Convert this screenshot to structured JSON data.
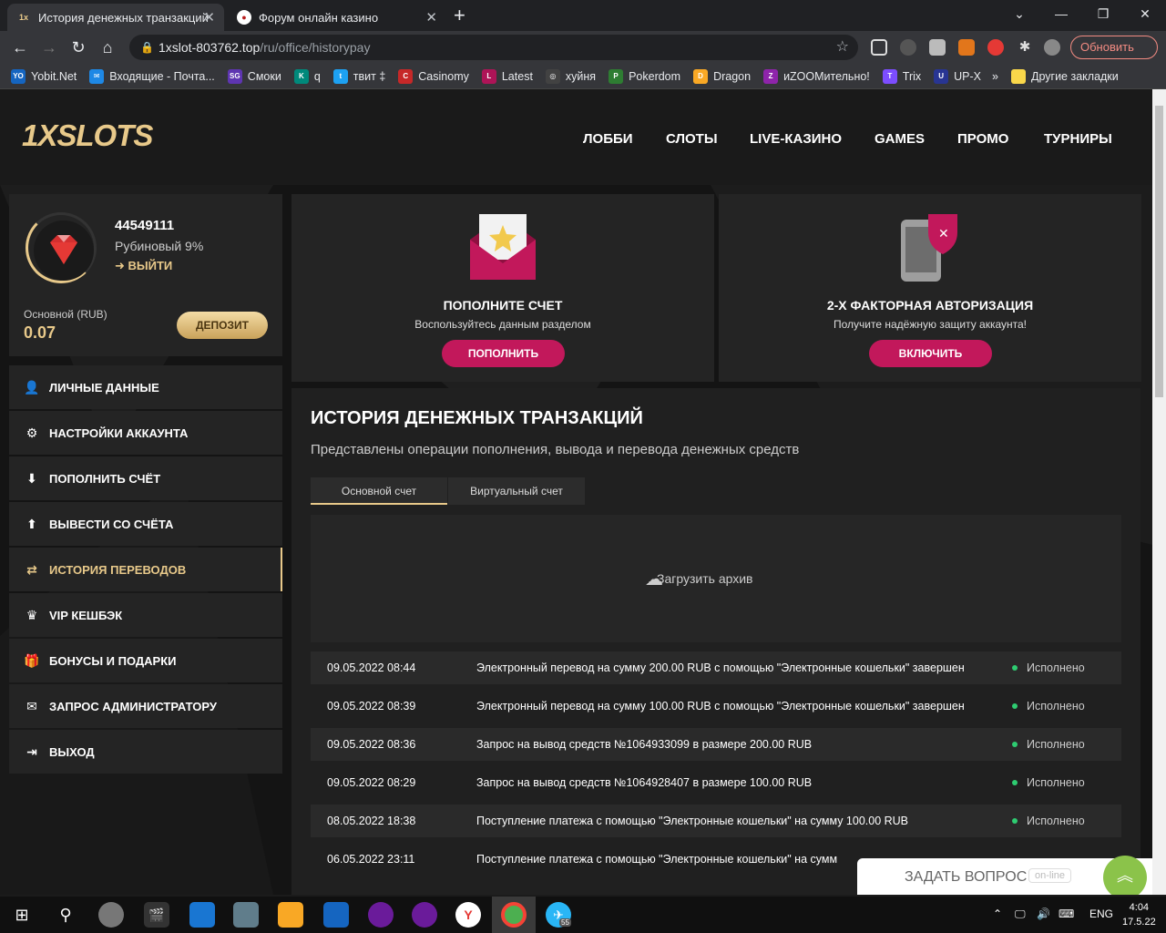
{
  "browser": {
    "tabs": [
      {
        "title": "История денежных транзакций",
        "favicon": "1x",
        "active": true
      },
      {
        "title": "Форум онлайн казино",
        "favicon": "forum",
        "active": false
      }
    ],
    "new_tab": "+",
    "url_host": "1xslot-803762.top",
    "url_path": "/ru/office/historypay",
    "update_button": "Обновить",
    "window_controls": {
      "minimize": "—",
      "maximize": "❐",
      "close": "✕"
    }
  },
  "bookmarks": [
    {
      "label": "Yobit.Net",
      "icon": "yobit-icon",
      "color": "#1565c0",
      "glyph": "YO"
    },
    {
      "label": "Входящие - Почта...",
      "icon": "mail-icon",
      "color": "#1e88e5",
      "glyph": "✉"
    },
    {
      "label": "Смоки",
      "icon": "smoke-icon",
      "color": "#5e35b1",
      "glyph": "SG"
    },
    {
      "label": "q",
      "icon": "k-icon",
      "color": "#00897b",
      "glyph": "K"
    },
    {
      "label": "твит ‡",
      "icon": "twitter-icon",
      "color": "#1da1f2",
      "glyph": "t"
    },
    {
      "label": "Casinomy",
      "icon": "casinomy-icon",
      "color": "#c62828",
      "glyph": "C"
    },
    {
      "label": "Latest",
      "icon": "latest-icon",
      "color": "#ad1457",
      "glyph": "L"
    },
    {
      "label": "хуйня",
      "icon": "circle-icon",
      "color": "#424242",
      "glyph": "◎"
    },
    {
      "label": "Pokerdom",
      "icon": "pokerdom-icon",
      "color": "#2e7d32",
      "glyph": "P"
    },
    {
      "label": "Dragon",
      "icon": "dragon-icon",
      "color": "#f9a825",
      "glyph": "D"
    },
    {
      "label": "иZOOМительно!",
      "icon": "zoom-icon",
      "color": "#8e24aa",
      "glyph": "Z"
    },
    {
      "label": "Trix",
      "icon": "trix-icon",
      "color": "#7c4dff",
      "glyph": "T"
    },
    {
      "label": "UP-X",
      "icon": "upx-icon",
      "color": "#283593",
      "glyph": "U"
    }
  ],
  "bookmarks_more": "»",
  "bookmarks_other": "Другие закладки",
  "site": {
    "logo": "1XSLOTS",
    "nav": [
      "ЛОББИ",
      "СЛОТЫ",
      "LIVE-КАЗИНО",
      "GAMES",
      "ПРОМО",
      "ТУРНИРЫ"
    ]
  },
  "profile": {
    "user_id": "44549111",
    "status": "Рубиновый 9%",
    "logout": "ВЫЙТИ",
    "balance_label": "Основной (RUB)",
    "balance": "0.07",
    "deposit_button": "ДЕПОЗИТ"
  },
  "menu": [
    {
      "label": "ЛИЧНЫЕ ДАННЫЕ",
      "icon": "user-edit-icon",
      "glyph": "👤"
    },
    {
      "label": "НАСТРОЙКИ АККАУНТА",
      "icon": "gears-icon",
      "glyph": "⚙"
    },
    {
      "label": "ПОПОЛНИТЬ СЧЁТ",
      "icon": "download-icon",
      "glyph": "⬇"
    },
    {
      "label": "ВЫВЕСТИ СО СЧЁТА",
      "icon": "upload-icon",
      "glyph": "⬆"
    },
    {
      "label": "ИСТОРИЯ ПЕРЕВОДОВ",
      "icon": "transfer-icon",
      "glyph": "⇄",
      "active": true
    },
    {
      "label": "VIP КЕШБЭК",
      "icon": "crown-icon",
      "glyph": "♛"
    },
    {
      "label": "БОНУСЫ И ПОДАРКИ",
      "icon": "gift-icon",
      "glyph": "🎁"
    },
    {
      "label": "ЗАПРОС АДМИНИСТРАТОРУ",
      "icon": "envelope-icon",
      "glyph": "✉"
    },
    {
      "label": "ВЫХОД",
      "icon": "exit-icon",
      "glyph": "⇥"
    }
  ],
  "cards": [
    {
      "title": "ПОПОЛНИТЕ СЧЕТ",
      "subtitle": "Воспользуйтесь данным разделом",
      "button": "ПОПОЛНИТЬ",
      "icon": "envelope-star-icon"
    },
    {
      "title": "2-Х ФАКТОРНАЯ АВТОРИЗАЦИЯ",
      "subtitle": "Получите надёжную защиту аккаунта!",
      "button": "ВКЛЮЧИТЬ",
      "icon": "phone-shield-icon"
    }
  ],
  "history": {
    "title": "ИСТОРИЯ ДЕНЕЖНЫХ ТРАНЗАКЦИЙ",
    "subtitle": "Представлены операции пополнения, вывода и перевода денежных средств",
    "tabs": [
      "Основной счет",
      "Виртуальный счет"
    ],
    "archive": "Загрузить архив",
    "rows": [
      {
        "date": "09.05.2022 08:44",
        "text": "Электронный перевод на сумму 200.00 RUB с помощью \"Электронные кошельки\" завершен",
        "status": "Исполнено"
      },
      {
        "date": "09.05.2022 08:39",
        "text": "Электронный перевод на сумму 100.00 RUB с помощью \"Электронные кошельки\" завершен",
        "status": "Исполнено"
      },
      {
        "date": "09.05.2022 08:36",
        "text": "Запрос на вывод средств №1064933099 в размере 200.00 RUB",
        "status": "Исполнено"
      },
      {
        "date": "09.05.2022 08:29",
        "text": "Запрос на вывод средств №1064928407 в размере 100.00 RUB",
        "status": "Исполнено"
      },
      {
        "date": "08.05.2022 18:38",
        "text": "Поступление платежа с помощью \"Электронные кошельки\" на сумму 100.00 RUB",
        "status": "Исполнено"
      },
      {
        "date": "06.05.2022 23:11",
        "text": "Поступление платежа с помощью \"Электронные кошельки\" на сумм",
        "status": ""
      }
    ]
  },
  "chat": {
    "label": "ЗАДАТЬ ВОПРОС",
    "badge": "on-line"
  },
  "taskbar": {
    "lang": "ENG",
    "time": "4:04",
    "date": "17.5.22",
    "telegram_badge": "55"
  }
}
